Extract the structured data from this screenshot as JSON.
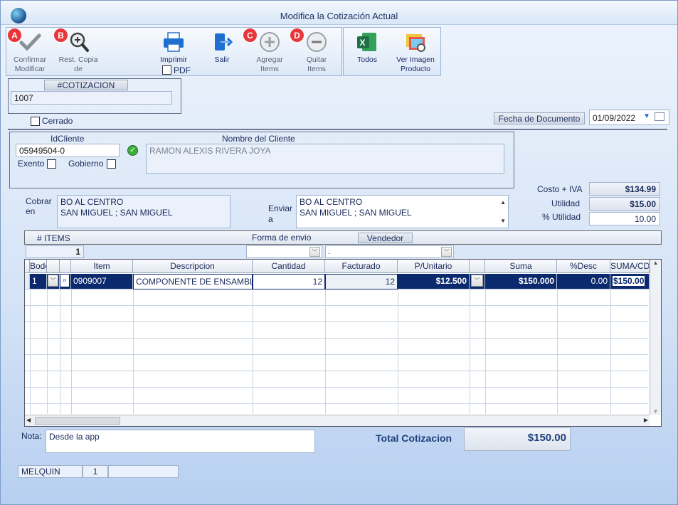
{
  "window": {
    "title": "Modifica la Cotización Actual"
  },
  "toolbar": {
    "confirmar": {
      "badge": "A",
      "label1": "Confirmar",
      "label2": "Modificar"
    },
    "restcopia": {
      "badge": "B",
      "label1": "Rest. Copia",
      "label2": "de"
    },
    "imprimir": {
      "label": "Imprimir",
      "pdf": "PDF"
    },
    "salir": {
      "label": "Salir"
    },
    "agregar": {
      "badge": "C",
      "label1": "Agregar",
      "label2": "Items"
    },
    "quitar": {
      "badge": "D",
      "label1": "Quitar",
      "label2": "Items"
    },
    "todos": {
      "label": "Todos"
    },
    "verimagen": {
      "label1": "Ver Imagen",
      "label2": "Producto"
    }
  },
  "cotizacion": {
    "header": "#COTIZACION",
    "value": "1007",
    "cerrado_label": "Cerrado"
  },
  "fecha": {
    "label": "Fecha de  Documento",
    "value": "01/09/2022"
  },
  "cliente": {
    "id_header": "IdCliente",
    "id_value": "05949504-0",
    "name_header": "Nombre del Cliente",
    "name_value": "RAMON ALEXIS RIVERA JOYA",
    "exento": "Exento",
    "gobierno": "Gobierno"
  },
  "direccion": {
    "cobrar_label1": "Cobrar",
    "cobrar_label2": "en",
    "cobrar_line1": "BO AL CENTRO",
    "cobrar_line2": "SAN MIGUEL ; SAN MIGUEL",
    "enviar_label1": "Enviar",
    "enviar_label2": "a",
    "enviar_line1": "BO AL CENTRO",
    "enviar_line2": "SAN MIGUEL ; SAN MIGUEL"
  },
  "totales": {
    "costo_label": "Costo + IVA",
    "costo_value": "$134.99",
    "utilidad_label": "Utilidad",
    "utilidad_value": "$15.00",
    "putilidad_label": "% Utilidad",
    "putilidad_value": "10.00"
  },
  "items_bar": {
    "items_label": "# ITEMS",
    "items_value": "1",
    "forma_label": "Forma de envio",
    "vendedor_label": "Vendedor",
    "vendedor_value": "."
  },
  "grid": {
    "headers": [
      "Bodega",
      "",
      "Item",
      "Descripcion",
      "Cantidad",
      "Facturado",
      "P/Unitario",
      "",
      "Suma",
      "%Desc",
      "SUMA/CD"
    ],
    "row": {
      "bodega": "1",
      "item": "0909007",
      "descripcion": "COMPONENTE DE ENSAMBLE",
      "cantidad": "12",
      "facturado": "12",
      "punitario": "$12.500",
      "suma": "$150.000",
      "desc": "0.00",
      "sumacd": "$150.00"
    }
  },
  "nota": {
    "label": "Nota:",
    "value": "Desde la app"
  },
  "total": {
    "label": "Total Cotizacion",
    "value": "$150.00"
  },
  "status": {
    "user": "MELQUIN",
    "num": "1"
  }
}
